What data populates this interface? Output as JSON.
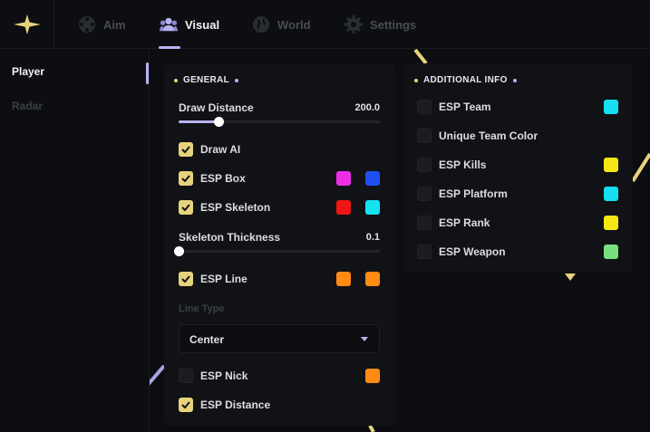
{
  "colors": {
    "accent_yellow": "#e6d37c",
    "accent_purple": "#b9b2f0",
    "bg": "#0c0d10",
    "panel": "#111216"
  },
  "logo": {
    "icon": "sparkle-star-icon"
  },
  "tabs": [
    {
      "label": "Aim",
      "icon": "crosshair-icon",
      "active": false
    },
    {
      "label": "Visual",
      "icon": "users-icon",
      "active": true
    },
    {
      "label": "World",
      "icon": "globe-icon",
      "active": false
    },
    {
      "label": "Settings",
      "icon": "gear-icon",
      "active": false
    }
  ],
  "sidebar": {
    "items": [
      {
        "label": "Player",
        "active": true
      },
      {
        "label": "Radar",
        "active": false
      }
    ]
  },
  "general": {
    "title": "GENERAL",
    "draw_distance": {
      "label": "Draw Distance",
      "value": "200.0",
      "fill_fraction": 0.2
    },
    "draw_ai": {
      "label": "Draw AI",
      "checked": true
    },
    "esp_box": {
      "label": "ESP Box",
      "checked": true,
      "colors": [
        "#ee2ee6",
        "#1f4ff0"
      ]
    },
    "esp_skeleton": {
      "label": "ESP Skeleton",
      "checked": true,
      "colors": [
        "#f01616",
        "#16e3f0"
      ]
    },
    "skeleton_thickness": {
      "label": "Skeleton Thickness",
      "value": "0.1",
      "fill_fraction": 0.0
    },
    "esp_line": {
      "label": "ESP Line",
      "checked": true,
      "colors": [
        "#ff8a14",
        "#ff8a14"
      ]
    },
    "line_type": {
      "label": "Line Type",
      "selected": "Center"
    },
    "esp_nick": {
      "label": "ESP Nick",
      "checked": false,
      "colors": [
        "#ff8a14"
      ]
    },
    "esp_distance": {
      "label": "ESP Distance",
      "checked": true
    }
  },
  "additional": {
    "title": "ADDITIONAL INFO",
    "items": [
      {
        "label": "ESP Team",
        "checked": false,
        "color": "#16dff0"
      },
      {
        "label": "Unique Team Color",
        "checked": false,
        "color": null
      },
      {
        "label": "ESP Kills",
        "checked": false,
        "color": "#f5e614"
      },
      {
        "label": "ESP Platform",
        "checked": false,
        "color": "#16dff0"
      },
      {
        "label": "ESP Rank",
        "checked": false,
        "color": "#f5e614"
      },
      {
        "label": "ESP Weapon",
        "checked": false,
        "color": "#79e07f"
      }
    ]
  }
}
